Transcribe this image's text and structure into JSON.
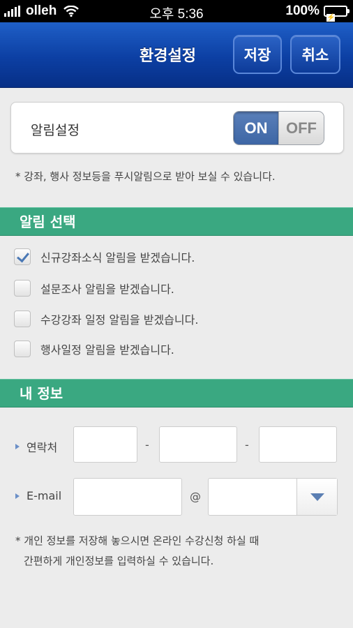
{
  "status_bar": {
    "carrier": "olleh",
    "time": "오후 5:36",
    "battery": "100%"
  },
  "nav": {
    "title": "환경설정",
    "save_label": "저장",
    "cancel_label": "취소"
  },
  "alarm": {
    "label": "알림설정",
    "toggle_on": "ON",
    "toggle_off": "OFF",
    "state": "ON",
    "note": "* 강좌, 행사 정보등을 푸시알림으로 받아 보실 수 있습니다."
  },
  "alarm_select": {
    "title": "알림 선택",
    "options": [
      {
        "label": "신규강좌소식 알림을 받겠습니다.",
        "checked": true
      },
      {
        "label": "설문조사 알림을 받겠습니다.",
        "checked": false
      },
      {
        "label": "수강강좌 일정 알림을 받겠습니다.",
        "checked": false
      },
      {
        "label": "행사일정 알림을 받겠습니다.",
        "checked": false
      }
    ]
  },
  "my_info": {
    "title": "내 정보",
    "contact_label": "연락처",
    "dash": "-",
    "email_label": "E-mail",
    "at": "@",
    "phone1": "",
    "phone2": "",
    "phone3": "",
    "email_id": "",
    "email_domain": "",
    "note_line1": "* 개인 정보를 저장해 놓으시면  온라인 수강신청 하실 때",
    "note_line2": "간편하게  개인정보를 입력하실 수 있습니다."
  },
  "colors": {
    "nav_blue": "#0c3fa3",
    "section_green": "#3aa881",
    "toggle_on_blue": "#4a70ad"
  }
}
